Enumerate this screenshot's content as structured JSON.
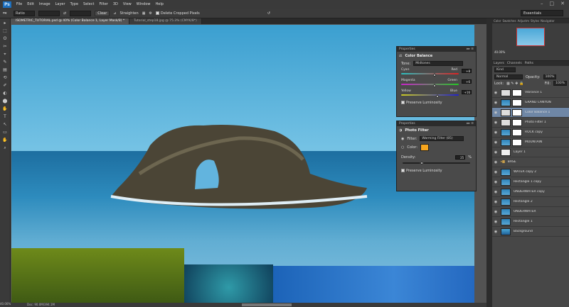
{
  "app": {
    "logo": "Ps"
  },
  "menu": [
    "File",
    "Edit",
    "Image",
    "Layer",
    "Type",
    "Select",
    "Filter",
    "3D",
    "View",
    "Window",
    "Help"
  ],
  "window_controls": [
    "–",
    "□",
    "✕"
  ],
  "options_bar": {
    "ratio_label": "Ratio",
    "clear_label": "Clear",
    "straighten_label": "Straighten",
    "delete_cropped_label": "Delete Cropped Pixels",
    "workspace": "Essentials"
  },
  "tabs": [
    {
      "label": "ISOMETRIC_TUTORIAL.psd @ 40% (Color Balance 1, Layer Mask/8) *",
      "active": true
    },
    {
      "label": "Tutorial_step18.jpg @ 75.3% (CMYK/8*)",
      "active": false
    }
  ],
  "tools": [
    "▸",
    "⬚",
    "ʘ",
    "✂",
    "⌖",
    "✎",
    "▤",
    "⟲",
    "✐",
    "◐",
    "⬤",
    "✋",
    "T",
    "↖",
    "▭",
    "✋",
    "⌕"
  ],
  "props_color_balance": {
    "header": "Properties",
    "title": "Color Balance",
    "tone_label": "Tone:",
    "tone_value": "Midtones",
    "sliders": [
      {
        "left": "Cyan",
        "right": "Red",
        "value": "+8",
        "pos": 0.56
      },
      {
        "left": "Magenta",
        "right": "Green",
        "value": "+6",
        "pos": 0.55
      },
      {
        "left": "Yellow",
        "right": "Blue",
        "value": "+16",
        "pos": 0.6
      }
    ],
    "preserve_label": "Preserve Luminosity"
  },
  "props_photo_filter": {
    "header": "Properties",
    "title": "Photo Filter",
    "filter_label": "Filter:",
    "filter_value": "Warming Filter (85)",
    "color_label": "Color:",
    "density_label": "Density:",
    "density_value": "25",
    "density_unit": "%",
    "density_pos": 0.25,
    "preserve_label": "Preserve Luminosity",
    "swatch_color": "#f7a51d"
  },
  "nav_panel": {
    "tabs": [
      "Color",
      "Swatches",
      "Adjustm",
      "Styles",
      "Navigator"
    ],
    "zoom": "40.00%"
  },
  "layers_panel": {
    "tabs": [
      "Layers",
      "Channels",
      "Paths"
    ],
    "kind_label": "Kind",
    "blend": "Normal",
    "opacity_label": "Opacity:",
    "opacity_value": "100%",
    "lock_label": "Lock:",
    "fill_label": "Fill:",
    "fill_value": "100%",
    "layers": [
      {
        "name": "Vibrance 1",
        "type": "adj",
        "selected": false
      },
      {
        "name": "GRAND CANYON",
        "type": "img",
        "selected": false
      },
      {
        "name": "Color Balance 1",
        "type": "adj",
        "selected": true
      },
      {
        "name": "Photo Filter 1",
        "type": "adj",
        "selected": false
      },
      {
        "name": "ROCK copy",
        "type": "img",
        "selected": false
      },
      {
        "name": "MOUNTAIN",
        "type": "img",
        "selected": false
      },
      {
        "name": "Layer 1",
        "type": "plain",
        "selected": false
      },
      {
        "name": "BASE",
        "type": "group",
        "selected": false
      },
      {
        "name": "WATER copy 2",
        "type": "img",
        "selected": false
      },
      {
        "name": "Rectangle 1 copy",
        "type": "img",
        "selected": false
      },
      {
        "name": "UNDERWATER copy",
        "type": "img",
        "selected": false
      },
      {
        "name": "Rectangle 2",
        "type": "img",
        "selected": false
      },
      {
        "name": "UNDERWATER",
        "type": "img",
        "selected": false
      },
      {
        "name": "Rectangle 1",
        "type": "img",
        "selected": false
      },
      {
        "name": "Background",
        "type": "bg",
        "selected": false
      }
    ]
  },
  "status": {
    "zoom": "40.00%",
    "doc": "Doc: 90.0M/394.1M"
  },
  "colors": {
    "accent": "#6f87a6",
    "panel": "#474747"
  }
}
